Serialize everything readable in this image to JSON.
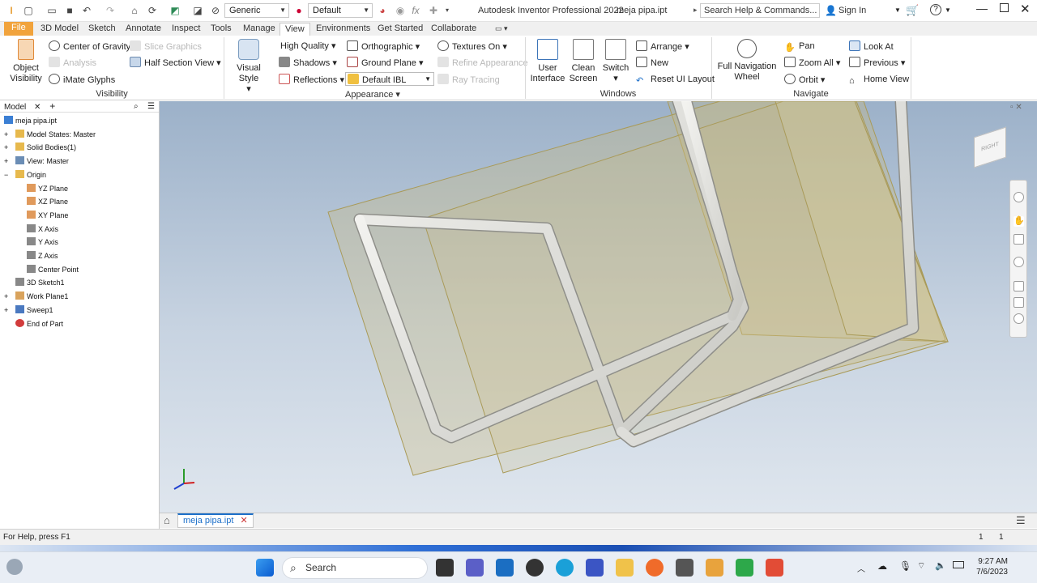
{
  "title": {
    "app": "Autodesk Inventor Professional 2022",
    "doc": "meja pipa.ipt",
    "search_placeholder": "Search Help & Commands...",
    "sign_in": "Sign In",
    "material_combo": "Generic",
    "appearance_combo": "Default",
    "fx": "fx"
  },
  "tabs": [
    "File",
    "3D Model",
    "Sketch",
    "Annotate",
    "Inspect",
    "Tools",
    "Manage",
    "View",
    "Environments",
    "Get Started",
    "Collaborate"
  ],
  "active_tab": "View",
  "ribbon": {
    "visibility": {
      "object_visibility": "Object\nVisibility",
      "object_visibility_l1": "Object",
      "object_visibility_l2": "Visibility",
      "center_of_gravity": "Center of Gravity",
      "analysis": "Analysis",
      "imate_glyphs": "iMate Glyphs",
      "slice_graphics": "Slice Graphics",
      "half_section_view": "Half Section View",
      "group": "Visibility"
    },
    "appearance": {
      "visual_style_l1": "Visual Style",
      "high_quality": "High Quality",
      "shadows": "Shadows",
      "reflections": "Reflections",
      "orthographic": "Orthographic",
      "ground_plane": "Ground Plane",
      "default_ibl": "Default IBL",
      "textures_on": "Textures On",
      "refine_appearance": "Refine Appearance",
      "ray_tracing": "Ray Tracing",
      "group": "Appearance"
    },
    "windows": {
      "user_interface_l1": "User",
      "user_interface_l2": "Interface",
      "clean_screen_l1": "Clean",
      "clean_screen_l2": "Screen",
      "switch": "Switch",
      "arrange": "Arrange",
      "new": "New",
      "reset_ui": "Reset UI Layout",
      "group": "Windows"
    },
    "navigate": {
      "full_nav_l1": "Full Navigation",
      "full_nav_l2": "Wheel",
      "pan": "Pan",
      "zoom_all": "Zoom All",
      "orbit": "Orbit",
      "look_at": "Look At",
      "previous": "Previous",
      "home_view": "Home View",
      "group": "Navigate"
    }
  },
  "browser": {
    "tab": "Model",
    "items": [
      {
        "label": "meja pipa.ipt",
        "level": 0,
        "icon": "part-icon",
        "expander": ""
      },
      {
        "label": "Model States: Master",
        "level": 1,
        "icon": "folder-icon",
        "expander": "+"
      },
      {
        "label": "Solid Bodies(1)",
        "level": 1,
        "icon": "folder-icon",
        "expander": "+"
      },
      {
        "label": "View: Master",
        "level": 1,
        "icon": "view-icon",
        "expander": "+"
      },
      {
        "label": "Origin",
        "level": 1,
        "icon": "folder-icon",
        "expander": "−"
      },
      {
        "label": "YZ Plane",
        "level": 2,
        "icon": "plane-icon",
        "expander": ""
      },
      {
        "label": "XZ Plane",
        "level": 2,
        "icon": "plane-icon",
        "expander": ""
      },
      {
        "label": "XY Plane",
        "level": 2,
        "icon": "plane-icon",
        "expander": ""
      },
      {
        "label": "X Axis",
        "level": 2,
        "icon": "axis-icon",
        "expander": ""
      },
      {
        "label": "Y Axis",
        "level": 2,
        "icon": "axis-icon",
        "expander": ""
      },
      {
        "label": "Z Axis",
        "level": 2,
        "icon": "axis-icon",
        "expander": ""
      },
      {
        "label": "Center Point",
        "level": 2,
        "icon": "point-icon",
        "expander": ""
      },
      {
        "label": "3D Sketch1",
        "level": 1,
        "icon": "sketch-icon",
        "expander": ""
      },
      {
        "label": "Work Plane1",
        "level": 1,
        "icon": "workplane-icon",
        "expander": "+"
      },
      {
        "label": "Sweep1",
        "level": 1,
        "icon": "sweep-icon",
        "expander": "+"
      },
      {
        "label": "End of Part",
        "level": 1,
        "icon": "end-of-part-icon",
        "expander": ""
      }
    ]
  },
  "doc_tab": "meja pipa.ipt",
  "status": {
    "help": "For Help, press F1",
    "count1": "1",
    "count2": "1"
  },
  "viewcube_label": "RIGHT",
  "taskbar": {
    "search": "Search",
    "time": "9:27 AM",
    "date": "7/6/2023"
  },
  "colors": {
    "file_tab": "#f1a33c",
    "accent": "#1c6fc9",
    "plane_fill": "#cdbb7a"
  }
}
